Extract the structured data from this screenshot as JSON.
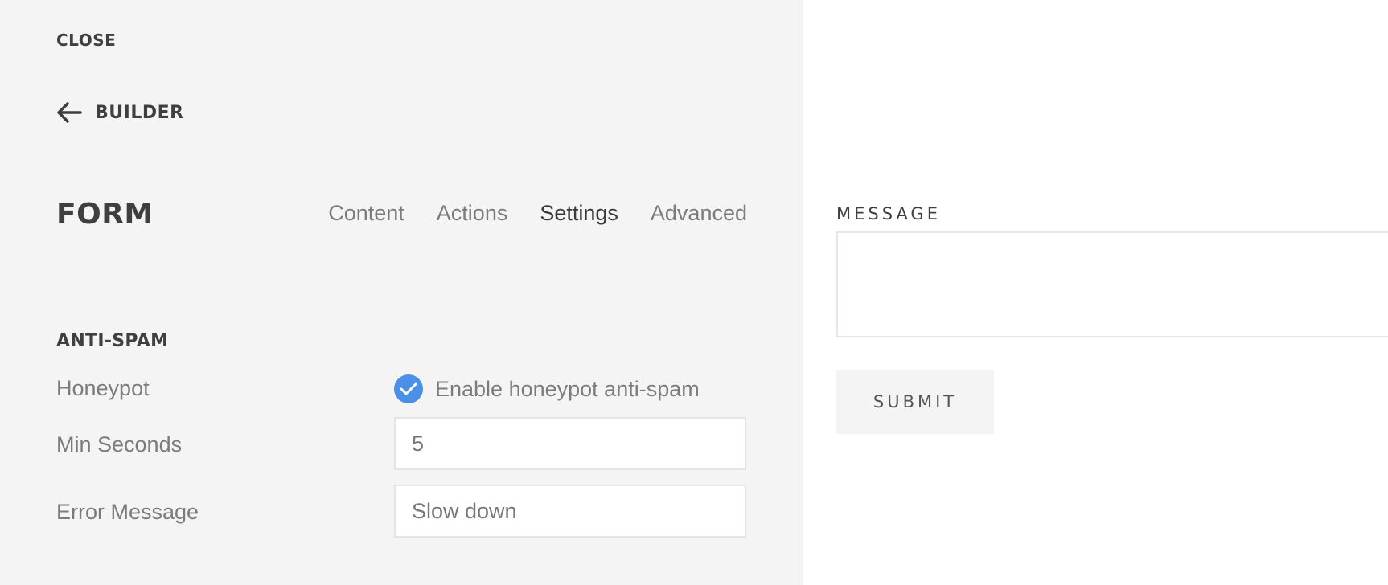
{
  "panel": {
    "close_label": "CLOSE",
    "back_label": "BUILDER",
    "title": "FORM",
    "tabs": [
      {
        "label": "Content",
        "active": false
      },
      {
        "label": "Actions",
        "active": false
      },
      {
        "label": "Settings",
        "active": true
      },
      {
        "label": "Advanced",
        "active": false
      }
    ],
    "section_title": "ANTI-SPAM",
    "fields": {
      "honeypot": {
        "label": "Honeypot",
        "checkbox_label": "Enable honeypot anti-spam",
        "checked": true
      },
      "min_seconds": {
        "label": "Min Seconds",
        "value": "5"
      },
      "error_message": {
        "label": "Error Message",
        "value": "Slow down"
      }
    }
  },
  "preview": {
    "message_label": "MESSAGE",
    "submit_label": "SUBMIT"
  },
  "icons": {
    "back": "arrow-left-icon",
    "check": "checkmark-icon"
  },
  "colors": {
    "panel_bg": "#f4f4f4",
    "accent": "#4c8fe6",
    "text_dark": "#3f3f3f",
    "text_muted": "#7b7b7b"
  }
}
